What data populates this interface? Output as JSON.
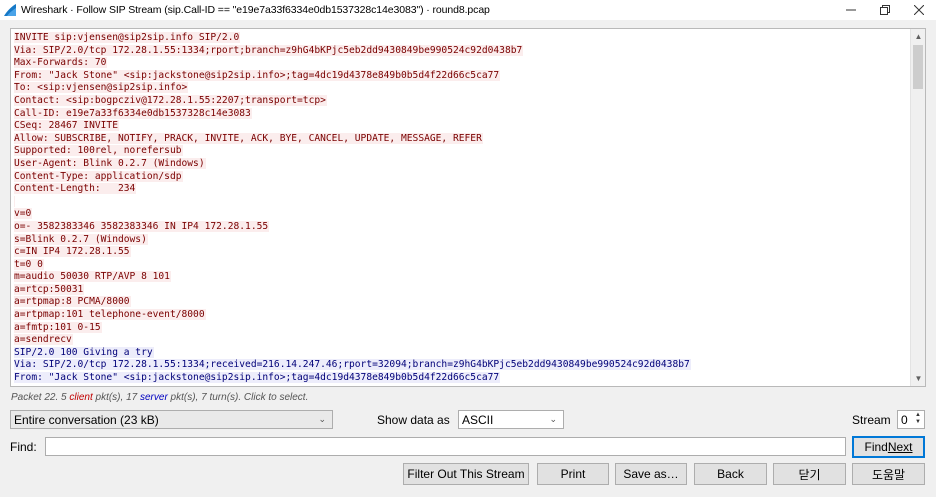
{
  "window": {
    "title": "Wireshark · Follow SIP Stream (sip.Call-ID == \"e19e7a33f6334e0db1537328c14e3083\") · round8.pcap",
    "icon": "wireshark-fin-icon"
  },
  "stream": {
    "lines": [
      {
        "dir": "client",
        "text": "INVITE sip:vjensen@sip2sip.info SIP/2.0"
      },
      {
        "dir": "client",
        "text": "Via: SIP/2.0/tcp 172.28.1.55:1334;rport;branch=z9hG4bKPjc5eb2dd9430849be990524c92d0438b7"
      },
      {
        "dir": "client",
        "text": "Max-Forwards: 70"
      },
      {
        "dir": "client",
        "text": "From: \"Jack Stone\" <sip:jackstone@sip2sip.info>;tag=4dc19d4378e849b0b5d4f22d66c5ca77"
      },
      {
        "dir": "client",
        "text": "To: <sip:vjensen@sip2sip.info>"
      },
      {
        "dir": "client",
        "text": "Contact: <sip:bogpcziv@172.28.1.55:2207;transport=tcp>"
      },
      {
        "dir": "client",
        "text": "Call-ID: e19e7a33f6334e0db1537328c14e3083"
      },
      {
        "dir": "client",
        "text": "CSeq: 28467 INVITE"
      },
      {
        "dir": "client",
        "text": "Allow: SUBSCRIBE, NOTIFY, PRACK, INVITE, ACK, BYE, CANCEL, UPDATE, MESSAGE, REFER"
      },
      {
        "dir": "client",
        "text": "Supported: 100rel, norefersub"
      },
      {
        "dir": "client",
        "text": "User-Agent: Blink 0.2.7 (Windows)"
      },
      {
        "dir": "client",
        "text": "Content-Type: application/sdp"
      },
      {
        "dir": "client",
        "text": "Content-Length:   234"
      },
      {
        "dir": "client",
        "text": ""
      },
      {
        "dir": "client",
        "text": "v=0"
      },
      {
        "dir": "client",
        "text": "o=- 3582383346 3582383346 IN IP4 172.28.1.55"
      },
      {
        "dir": "client",
        "text": "s=Blink 0.2.7 (Windows)"
      },
      {
        "dir": "client",
        "text": "c=IN IP4 172.28.1.55"
      },
      {
        "dir": "client",
        "text": "t=0 0"
      },
      {
        "dir": "client",
        "text": "m=audio 50030 RTP/AVP 8 101"
      },
      {
        "dir": "client",
        "text": "a=rtcp:50031"
      },
      {
        "dir": "client",
        "text": "a=rtpmap:8 PCMA/8000"
      },
      {
        "dir": "client",
        "text": "a=rtpmap:101 telephone-event/8000"
      },
      {
        "dir": "client",
        "text": "a=fmtp:101 0-15"
      },
      {
        "dir": "client",
        "text": "a=sendrecv"
      },
      {
        "dir": "server",
        "text": "SIP/2.0 100 Giving a try"
      },
      {
        "dir": "server",
        "text": "Via: SIP/2.0/tcp 172.28.1.55:1334;received=216.14.247.46;rport=32094;branch=z9hG4bKPjc5eb2dd9430849be990524c92d0438b7"
      },
      {
        "dir": "server",
        "text": "From: \"Jack Stone\" <sip:jackstone@sip2sip.info>;tag=4dc19d4378e849b0b5d4f22d66c5ca77"
      }
    ]
  },
  "status": {
    "prefix": "Packet 22. 5 ",
    "client_word": "client",
    "middle": " pkt(s), 17 ",
    "server_word": "server",
    "suffix": " pkt(s), 7 turn(s). Click to select."
  },
  "controls": {
    "conversation_value": "Entire conversation (23 kB)",
    "show_data_label": "Show data as",
    "show_data_value": "ASCII",
    "stream_label": "Stream",
    "stream_value": "0",
    "find_label": "Find:",
    "find_value": "",
    "find_next_label_first": "Find ",
    "find_next_label_rest": "Next"
  },
  "buttons": {
    "filter_out": "Filter Out This Stream",
    "print": "Print",
    "save_as": "Save as…",
    "back": "Back",
    "close": "닫기",
    "help": "도움말"
  },
  "colors": {
    "client_fg": "#7a0000",
    "client_bg": "#fbeded",
    "server_fg": "#000078",
    "server_bg": "#ededfb"
  }
}
